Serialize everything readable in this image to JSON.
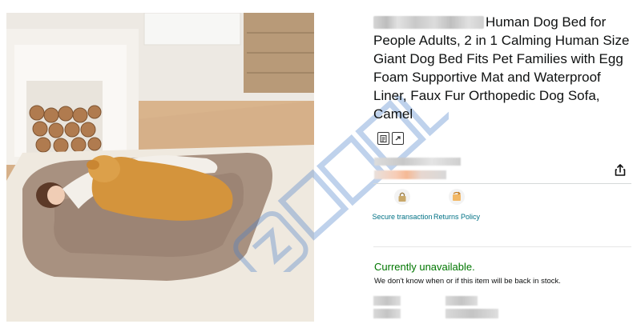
{
  "product": {
    "title": "Human Dog Bed for People Adults, 2 in 1 Calming Human Size Giant Dog Bed Fits Pet Families with Egg Foam Supportive Mat and Waterproof Liner, Faux Fur Orthopedic Dog Sofa, Camel"
  },
  "features": [
    {
      "label": "Secure transaction",
      "icon": "lock-icon"
    },
    {
      "label": "Returns Policy",
      "icon": "returns-icon"
    }
  ],
  "availability": {
    "status": "Currently unavailable.",
    "note": "We don't know when or if this item will be back in stock."
  },
  "colors": {
    "unavailable": "#007600",
    "link": "#007185",
    "watermark": "#4a7fc9"
  }
}
